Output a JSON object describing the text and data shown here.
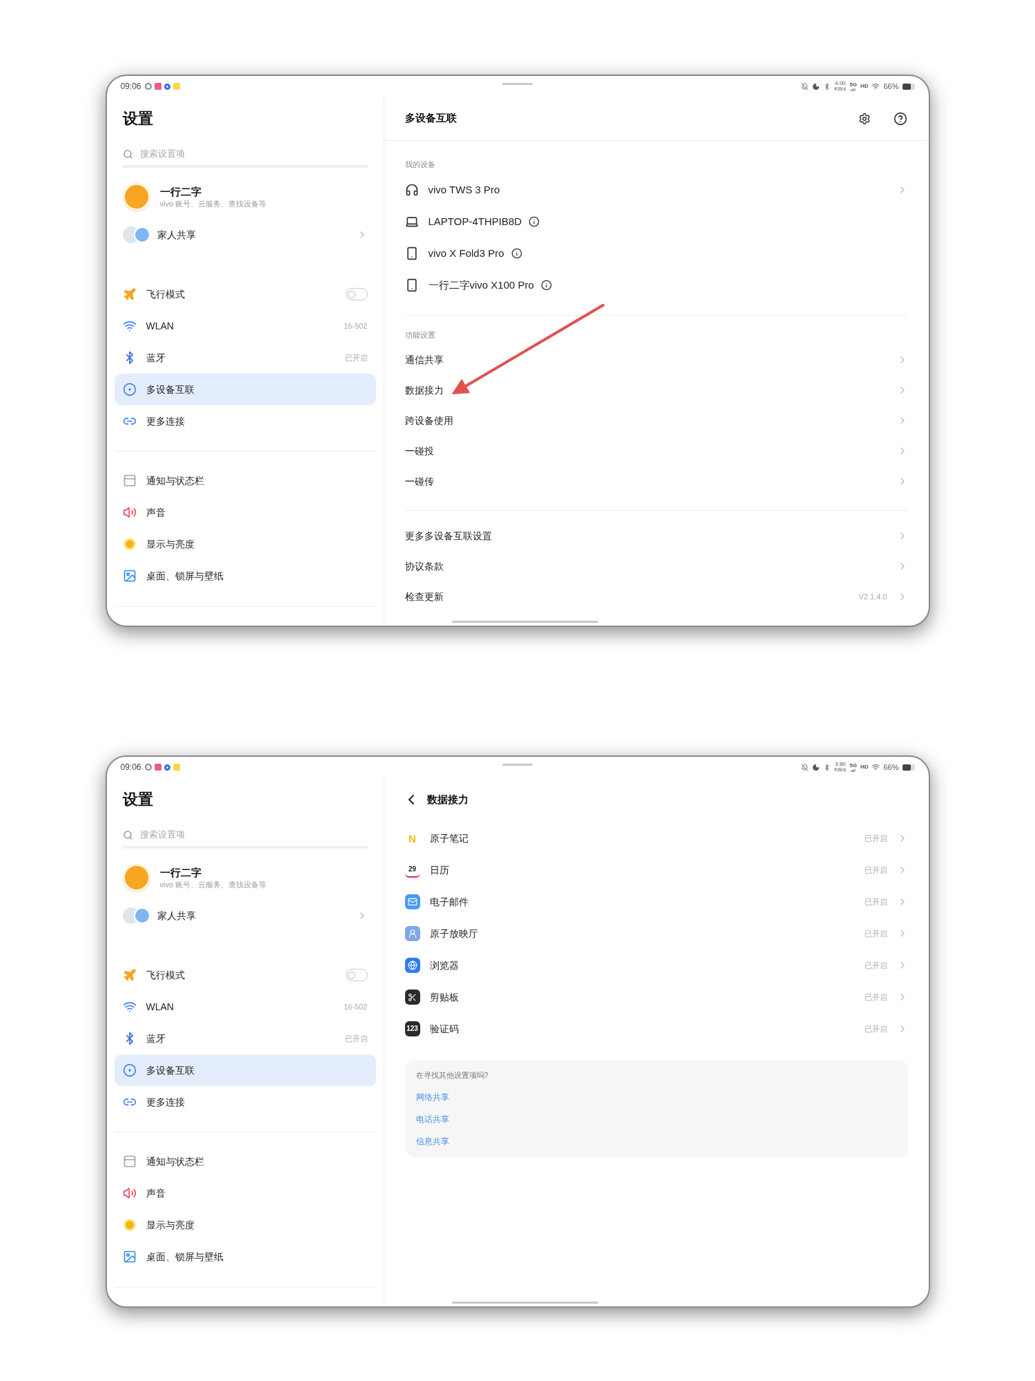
{
  "screens": [
    {
      "status_bar": {
        "time": "09:06",
        "speed": "4.00",
        "speed_unit": "KB/s",
        "network": "5G",
        "hd": "HD",
        "battery": "66%"
      },
      "sidebar": {
        "title": "设置",
        "search_placeholder": "搜索设置项",
        "account": {
          "name": "一行二字",
          "subtitle": "vivo 账号、云服务、查找设备等"
        },
        "family": {
          "label": "家人共享"
        },
        "groups": [
          {
            "items": [
              {
                "label": "飞行模式",
                "kind": "toggle",
                "on": false,
                "selected": false
              },
              {
                "label": "WLAN",
                "kind": "value",
                "value": "16-502",
                "selected": false
              },
              {
                "label": "蓝牙",
                "kind": "value",
                "value": "已开启",
                "selected": false
              },
              {
                "label": "多设备互联",
                "kind": "plain",
                "selected": true
              },
              {
                "label": "更多连接",
                "kind": "plain",
                "selected": false
              }
            ]
          },
          {
            "items": [
              {
                "label": "通知与状态栏",
                "kind": "plain",
                "selected": false
              },
              {
                "label": "声音",
                "kind": "plain",
                "selected": false
              },
              {
                "label": "显示与亮度",
                "kind": "plain",
                "selected": false
              },
              {
                "label": "桌面、锁屏与壁纸",
                "kind": "plain",
                "selected": false
              }
            ]
          }
        ]
      },
      "detail": {
        "kind": "overview",
        "title": "多设备互联",
        "sections": [
          {
            "header": "我的设备",
            "items": [
              {
                "label": "vivo TWS 3 Pro",
                "kind": "device",
                "chevron": true,
                "info": false
              },
              {
                "label": "LAPTOP-4THPIB8D",
                "kind": "device",
                "chevron": false,
                "info": true
              },
              {
                "label": "vivo X Fold3 Pro",
                "kind": "device",
                "chevron": false,
                "info": true
              },
              {
                "label": "一行二字vivo X100 Pro",
                "kind": "device",
                "chevron": false,
                "info": true
              }
            ]
          },
          {
            "header": "功能设置",
            "items": [
              {
                "label": "通信共享",
                "kind": "setting",
                "chevron": true,
                "info": false
              },
              {
                "label": "数据接力",
                "kind": "setting",
                "chevron": true,
                "info": false
              },
              {
                "label": "跨设备使用",
                "kind": "setting",
                "chevron": true,
                "info": false
              },
              {
                "label": "一碰投",
                "kind": "setting",
                "chevron": true,
                "info": false
              },
              {
                "label": "一碰传",
                "kind": "setting",
                "chevron": true,
                "info": false
              }
            ]
          },
          {
            "items": [
              {
                "label": "更多多设备互联设置",
                "kind": "setting",
                "chevron": true,
                "info": false
              },
              {
                "label": "协议条款",
                "kind": "setting",
                "chevron": true,
                "info": false
              },
              {
                "label": "检查更新",
                "kind": "setting",
                "chevron": true,
                "info": false,
                "value": "V2.1.4.0"
              }
            ]
          }
        ]
      },
      "annotation_arrow": true
    },
    {
      "status_bar": {
        "time": "09:06",
        "speed": "3.80",
        "speed_unit": "KB/s",
        "network": "5G",
        "hd": "HD",
        "battery": "66%"
      },
      "sidebar": {
        "title": "设置",
        "search_placeholder": "搜索设置项",
        "account": {
          "name": "一行二字",
          "subtitle": "vivo 账号、云服务、查找设备等"
        },
        "family": {
          "label": "家人共享"
        },
        "groups": [
          {
            "items": [
              {
                "label": "飞行模式",
                "kind": "toggle",
                "on": false,
                "selected": false
              },
              {
                "label": "WLAN",
                "kind": "value",
                "value": "16-502",
                "selected": false
              },
              {
                "label": "蓝牙",
                "kind": "value",
                "value": "已开启",
                "selected": false
              },
              {
                "label": "多设备互联",
                "kind": "plain",
                "selected": true
              },
              {
                "label": "更多连接",
                "kind": "plain",
                "selected": false
              }
            ]
          },
          {
            "items": [
              {
                "label": "通知与状态栏",
                "kind": "plain",
                "selected": false
              },
              {
                "label": "声音",
                "kind": "plain",
                "selected": false
              },
              {
                "label": "显示与亮度",
                "kind": "plain",
                "selected": false
              },
              {
                "label": "桌面、锁屏与壁纸",
                "kind": "plain",
                "selected": false
              }
            ]
          }
        ]
      },
      "detail": {
        "kind": "subpage",
        "title": "数据接力",
        "apps": [
          {
            "name": "原子笔记",
            "status": "已开启",
            "icon_label": "N"
          },
          {
            "name": "日历",
            "status": "已开启",
            "icon_label": "29"
          },
          {
            "name": "电子邮件",
            "status": "已开启"
          },
          {
            "name": "原子放映厅",
            "status": "已开启"
          },
          {
            "name": "浏览器",
            "status": "已开启"
          },
          {
            "name": "剪贴板",
            "status": "已开启"
          },
          {
            "name": "验证码",
            "status": "已开启",
            "icon_label": "123"
          }
        ],
        "help": {
          "title": "在寻找其他设置项吗?",
          "links": [
            "网络共享",
            "电话共享",
            "信息共享"
          ]
        }
      },
      "annotation_arrow": false
    }
  ]
}
